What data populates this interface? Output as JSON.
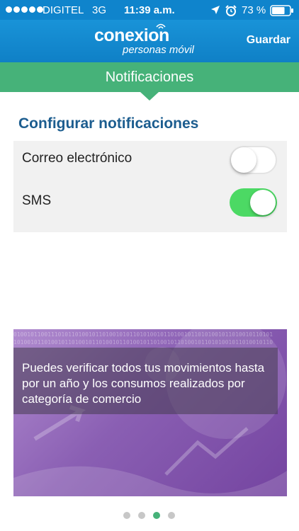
{
  "status_bar": {
    "carrier": "DIGITEL",
    "network": "3G",
    "time": "11:39 a.m.",
    "battery": "73 %",
    "signal_bars": 5,
    "battery_level": 0.73,
    "icons": [
      "location-arrow-icon",
      "alarm-clock-icon",
      "battery-icon"
    ]
  },
  "header": {
    "logo_main": "conexion",
    "logo_sub": "personas móvil",
    "save_label": "Guardar"
  },
  "section": {
    "title": "Notificaciones"
  },
  "settings": {
    "heading": "Configurar notificaciones",
    "items": [
      {
        "label": "Correo electrónico",
        "enabled": false
      },
      {
        "label": "SMS",
        "enabled": true
      }
    ]
  },
  "banner": {
    "text": "Puedes verificar todos tus movimientos hasta por un año y los consumos realizados por categoría de comercio"
  },
  "pager": {
    "total": 4,
    "active_index": 2
  },
  "colors": {
    "header_blue": "#0f84cc",
    "section_green": "#46b279",
    "heading_blue": "#1c5d8f",
    "toggle_on": "#4cd964",
    "banner_purple": "#8a5fb3"
  }
}
